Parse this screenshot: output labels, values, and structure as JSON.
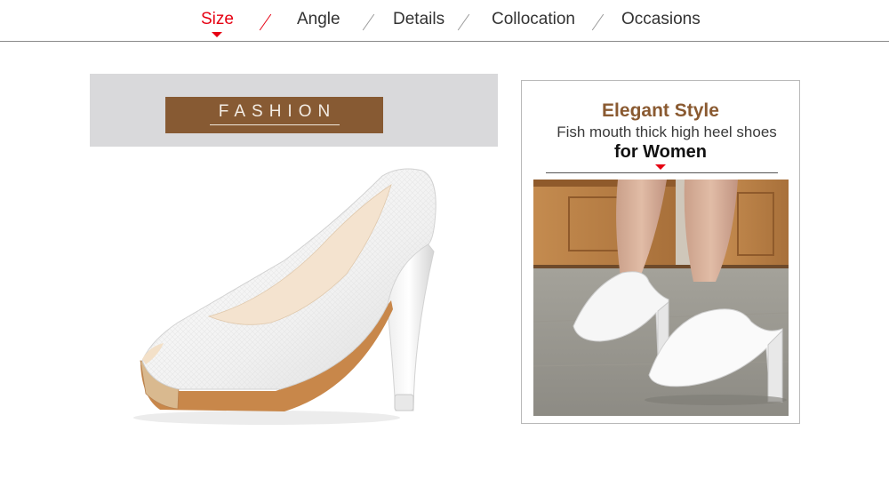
{
  "nav": {
    "tabs": [
      {
        "label": "Size",
        "active": true
      },
      {
        "label": "Angle",
        "active": false
      },
      {
        "label": "Details",
        "active": false
      },
      {
        "label": "Collocation",
        "active": false
      },
      {
        "label": "Occasions",
        "active": false
      }
    ],
    "active_color": "#e60012"
  },
  "fashion": {
    "label": "FASHION",
    "band_color": "#d9d9db",
    "box_color": "#875a33"
  },
  "card": {
    "title": "Elegant Style",
    "subtitle": "Fish mouth thick high heel shoes",
    "subtitle2": "for Women",
    "title_color": "#8a5a31"
  },
  "colors": {
    "accent": "#e60012"
  }
}
